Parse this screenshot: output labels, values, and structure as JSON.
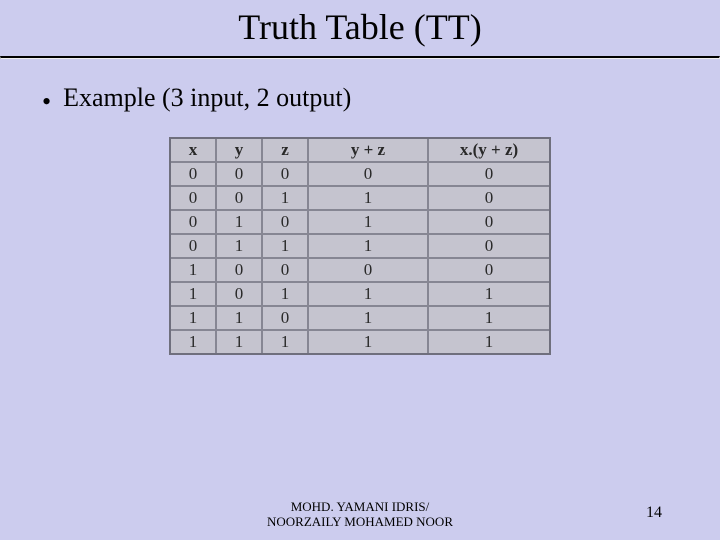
{
  "title": "Truth Table (TT)",
  "bullet": "Example (3 input, 2 output)",
  "chart_data": {
    "type": "table",
    "headers": [
      "x",
      "y",
      "z",
      "y + z",
      "x.(y + z)"
    ],
    "rows": [
      [
        "0",
        "0",
        "0",
        "0",
        "0"
      ],
      [
        "0",
        "0",
        "1",
        "1",
        "0"
      ],
      [
        "0",
        "1",
        "0",
        "1",
        "0"
      ],
      [
        "0",
        "1",
        "1",
        "1",
        "0"
      ],
      [
        "1",
        "0",
        "0",
        "0",
        "0"
      ],
      [
        "1",
        "0",
        "1",
        "1",
        "1"
      ],
      [
        "1",
        "1",
        "0",
        "1",
        "1"
      ],
      [
        "1",
        "1",
        "1",
        "1",
        "1"
      ]
    ]
  },
  "footer": {
    "author_line1": "MOHD. YAMANI IDRIS/",
    "author_line2": "NOORZAILY MOHAMED NOOR",
    "page": "14"
  }
}
